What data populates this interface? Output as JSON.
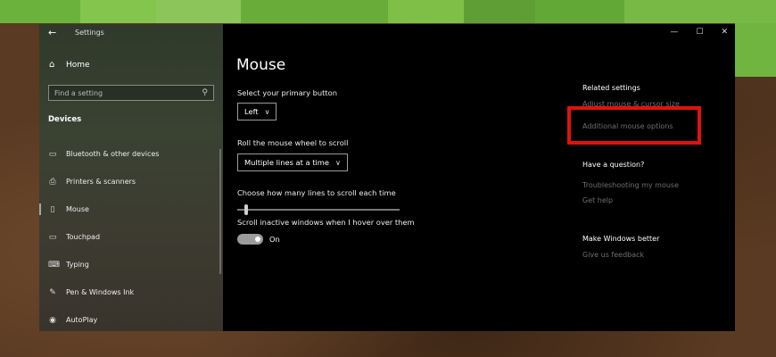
{
  "window": {
    "title": "Settings",
    "controls": {
      "minimize": "—",
      "maximize": "☐",
      "close": "✕"
    }
  },
  "sidebar": {
    "home_label": "Home",
    "search_placeholder": "Find a setting",
    "section_heading": "Devices",
    "items": [
      {
        "label": "Bluetooth & other devices",
        "icon": "bluetooth-devices-icon",
        "glyph": "▭"
      },
      {
        "label": "Printers & scanners",
        "icon": "printer-icon",
        "glyph": "⎙"
      },
      {
        "label": "Mouse",
        "icon": "mouse-icon",
        "glyph": "▯"
      },
      {
        "label": "Touchpad",
        "icon": "touchpad-icon",
        "glyph": "▭"
      },
      {
        "label": "Typing",
        "icon": "keyboard-icon",
        "glyph": "⌨"
      },
      {
        "label": "Pen & Windows Ink",
        "icon": "pen-icon",
        "glyph": "✎"
      },
      {
        "label": "AutoPlay",
        "icon": "autoplay-icon",
        "glyph": "◉"
      }
    ],
    "active_index": 2
  },
  "main": {
    "page_title": "Mouse",
    "primary_button": {
      "label": "Select your primary button",
      "value": "Left"
    },
    "scroll_wheel": {
      "label": "Roll the mouse wheel to scroll",
      "value": "Multiple lines at a time"
    },
    "lines_slider": {
      "label": "Choose how many lines to scroll each time",
      "value_fraction": 0.02
    },
    "inactive_scroll": {
      "label": "Scroll inactive windows when I hover over them",
      "state": "On"
    }
  },
  "related": {
    "heading": "Related settings",
    "links": [
      "Adjust mouse & cursor size",
      "Additional mouse options"
    ],
    "question_heading": "Have a question?",
    "question_links": [
      "Troubleshooting my mouse",
      "Get help"
    ],
    "better_heading": "Make Windows better",
    "better_links": [
      "Give us feedback"
    ]
  },
  "colors": {
    "highlight": "#e1120f",
    "link_gray": "#6f6f6f"
  }
}
